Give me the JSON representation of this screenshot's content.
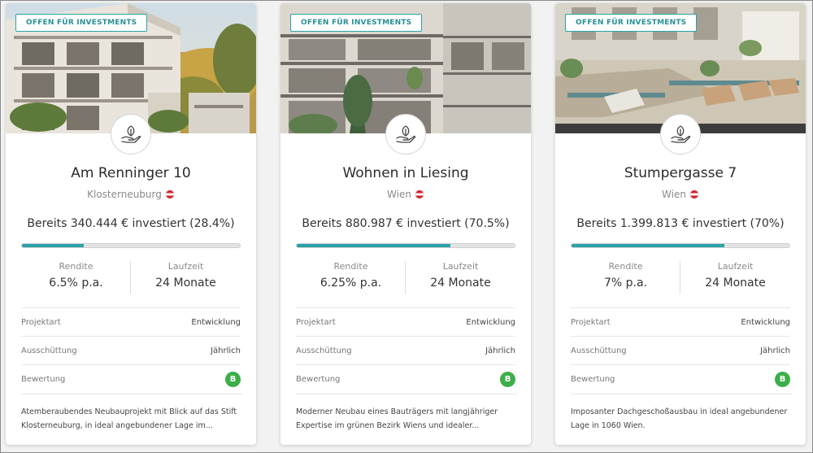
{
  "colors": {
    "accent": "#2aa3a8",
    "rating": "#3dae4a",
    "flag_red": "#d6202c"
  },
  "projects": [
    {
      "badge": "OFFEN FÜR INVESTMENTS",
      "title": "Am Renninger 10",
      "location": "Klosterneuburg",
      "flag_icon": "austria-flag-icon",
      "invested_text": "Bereits 340.444 € investiert (28.4%)",
      "progress_percent": 28.4,
      "rendite_label": "Rendite",
      "rendite_value": "6.5% p.a.",
      "laufzeit_label": "Laufzeit",
      "laufzeit_value": "24 Monate",
      "projektart_label": "Projektart",
      "projektart_value": "Entwicklung",
      "ausschuettung_label": "Ausschüttung",
      "ausschuettung_value": "Jährlich",
      "bewertung_label": "Bewertung",
      "bewertung_value": "B",
      "description": "Atemberaubendes Neubauprojekt mit Blick auf das Stift Klosterneuburg, in ideal angebundener Lage im..."
    },
    {
      "badge": "OFFEN FÜR INVESTMENTS",
      "title": "Wohnen in Liesing",
      "location": "Wien",
      "flag_icon": "austria-flag-icon",
      "invested_text": "Bereits 880.987 € investiert (70.5%)",
      "progress_percent": 70.5,
      "rendite_label": "Rendite",
      "rendite_value": "6.25% p.a.",
      "laufzeit_label": "Laufzeit",
      "laufzeit_value": "24 Monate",
      "projektart_label": "Projektart",
      "projektart_value": "Entwicklung",
      "ausschuettung_label": "Ausschüttung",
      "ausschuettung_value": "Jährlich",
      "bewertung_label": "Bewertung",
      "bewertung_value": "B",
      "description": "Moderner Neubau eines Bauträgers mit langjähriger Expertise im grünen Bezirk Wiens und idealer..."
    },
    {
      "badge": "OFFEN FÜR INVESTMENTS",
      "title": "Stumpergasse 7",
      "location": "Wien",
      "flag_icon": "austria-flag-icon",
      "invested_text": "Bereits 1.399.813 € investiert (70%)",
      "progress_percent": 70,
      "rendite_label": "Rendite",
      "rendite_value": "7% p.a.",
      "laufzeit_label": "Laufzeit",
      "laufzeit_value": "24 Monate",
      "projektart_label": "Projektart",
      "projektart_value": "Entwicklung",
      "ausschuettung_label": "Ausschüttung",
      "ausschuettung_value": "Jährlich",
      "bewertung_label": "Bewertung",
      "bewertung_value": "B",
      "description": "Imposanter Dachgeschoßausbau in ideal angebundener Lage in 1060 Wien."
    }
  ]
}
